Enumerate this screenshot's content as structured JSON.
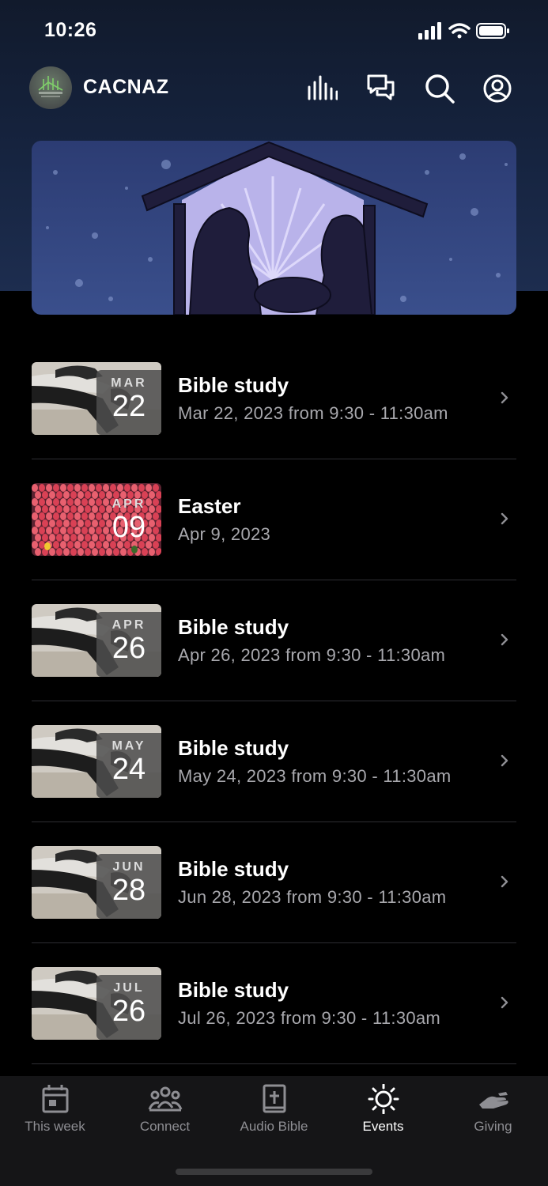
{
  "status_bar": {
    "time": "10:26"
  },
  "header": {
    "title": "CACNAZ"
  },
  "events": [
    {
      "month": "MAR",
      "day": "22",
      "title": "Bible study",
      "date": "Mar 22, 2023 from 9:30 - 11:30am",
      "thumb": "bible"
    },
    {
      "month": "APR",
      "day": "09",
      "title": "Easter",
      "date": "Apr 9, 2023",
      "thumb": "flowers"
    },
    {
      "month": "APR",
      "day": "26",
      "title": "Bible study",
      "date": "Apr 26, 2023 from 9:30 - 11:30am",
      "thumb": "bible"
    },
    {
      "month": "MAY",
      "day": "24",
      "title": "Bible study",
      "date": "May 24, 2023 from 9:30 - 11:30am",
      "thumb": "bible"
    },
    {
      "month": "JUN",
      "day": "28",
      "title": "Bible study",
      "date": "Jun 28, 2023 from 9:30 - 11:30am",
      "thumb": "bible"
    },
    {
      "month": "JUL",
      "day": "26",
      "title": "Bible study",
      "date": "Jul 26, 2023 from 9:30 - 11:30am",
      "thumb": "bible"
    }
  ],
  "tabs": [
    {
      "label": "This week",
      "icon": "calendar-icon",
      "active": false
    },
    {
      "label": "Connect",
      "icon": "people-icon",
      "active": false
    },
    {
      "label": "Audio Bible",
      "icon": "bible-icon",
      "active": false
    },
    {
      "label": "Events",
      "icon": "sun-icon",
      "active": true
    },
    {
      "label": "Giving",
      "icon": "giving-hand-icon",
      "active": false
    }
  ],
  "colors": {
    "accent": "#ffffff",
    "inactive": "#8e8e93",
    "background": "#000000",
    "tabbar": "#151517"
  }
}
